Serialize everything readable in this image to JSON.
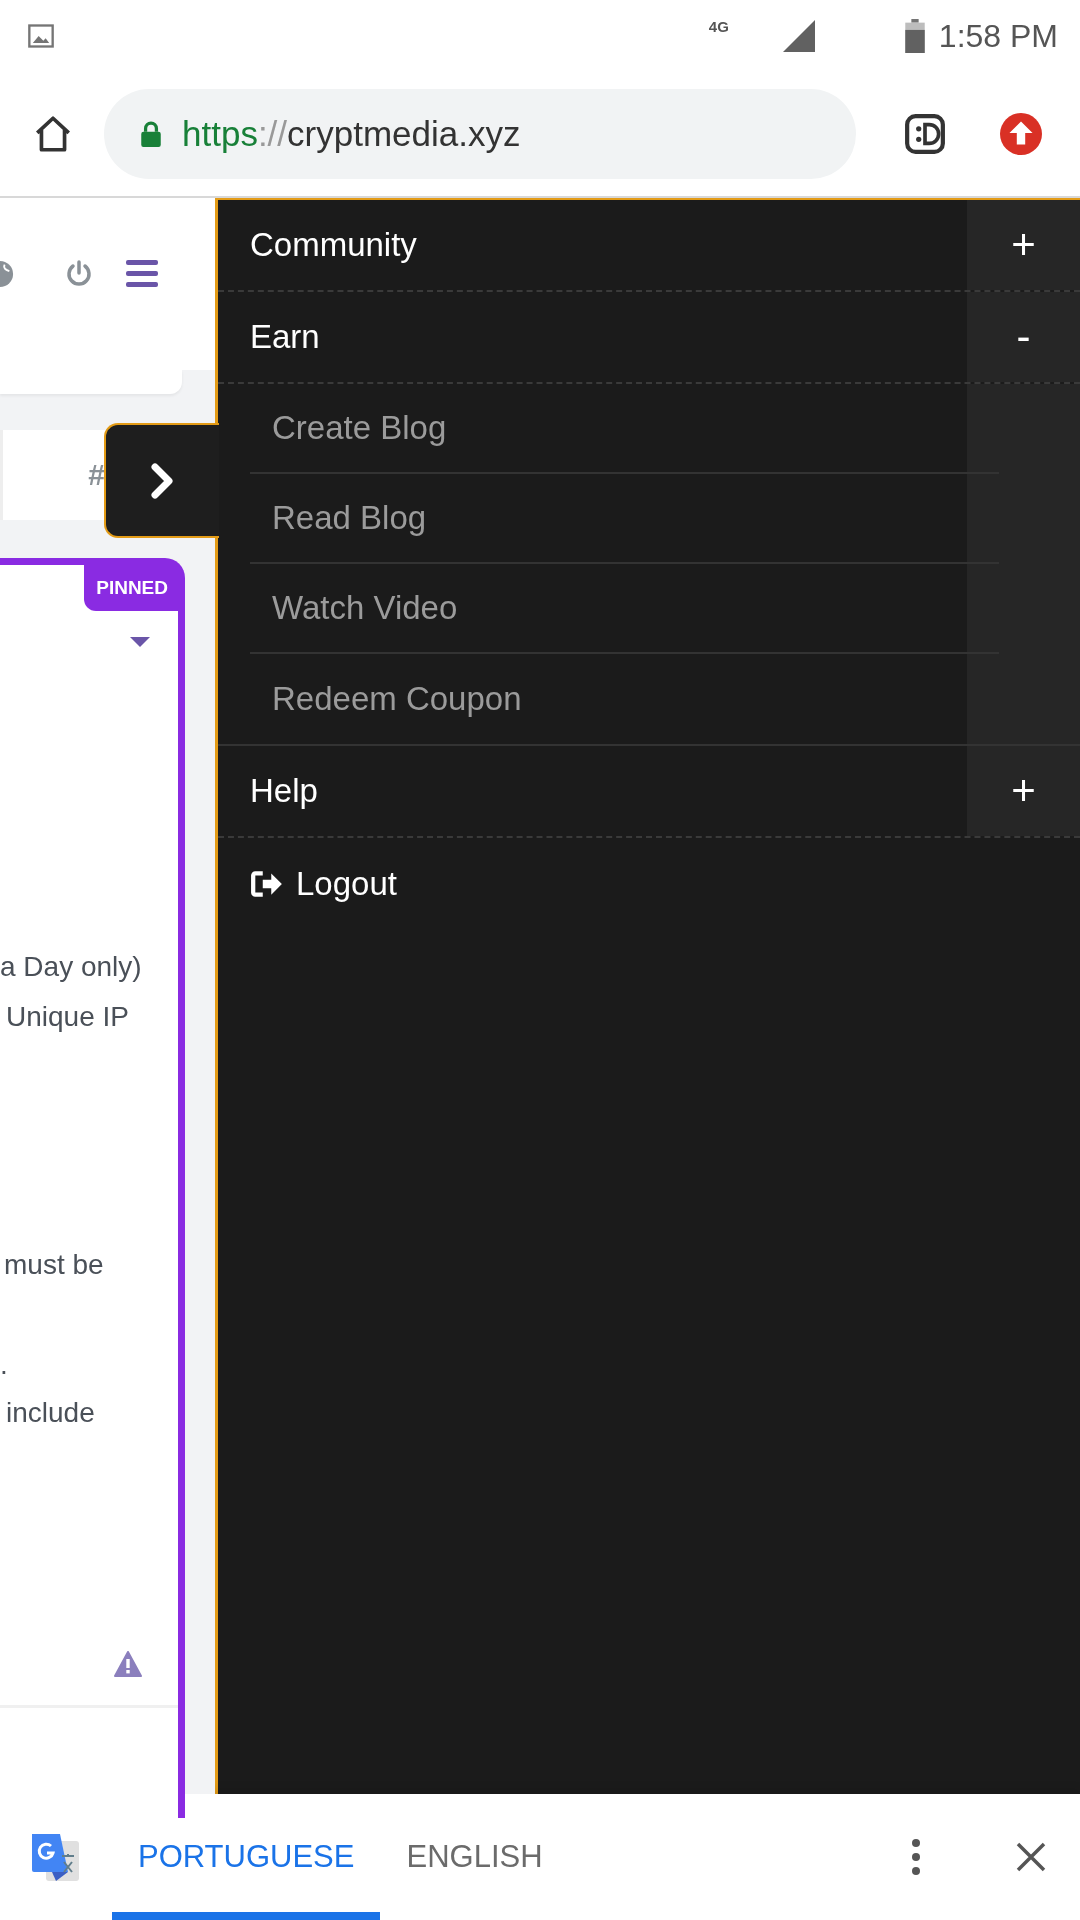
{
  "status_bar": {
    "network": "4G",
    "time": "1:58 PM"
  },
  "browser": {
    "url_scheme": "https",
    "url_separator": "://",
    "url_host": "cryptmedia.xyz"
  },
  "page": {
    "tab_label": "#",
    "pinned_badge": "PINNED",
    "text_lines": [
      "a Day only)",
      "Unique IP",
      "must be",
      ".",
      "include"
    ]
  },
  "menu": {
    "items": [
      {
        "kind": "group",
        "label": "Community",
        "toggle": "+"
      },
      {
        "kind": "group",
        "label": "Earn",
        "toggle": "-",
        "children": [
          {
            "label": "Create Blog"
          },
          {
            "label": "Read Blog"
          },
          {
            "label": "Watch Video"
          },
          {
            "label": "Redeem Coupon"
          }
        ]
      },
      {
        "kind": "group",
        "label": "Help",
        "toggle": "+"
      },
      {
        "kind": "link",
        "label": "Logout"
      }
    ]
  },
  "translate_bar": {
    "languages": [
      {
        "label": "PORTUGUESE",
        "selected": true
      },
      {
        "label": "ENGLISH",
        "selected": false
      }
    ]
  }
}
